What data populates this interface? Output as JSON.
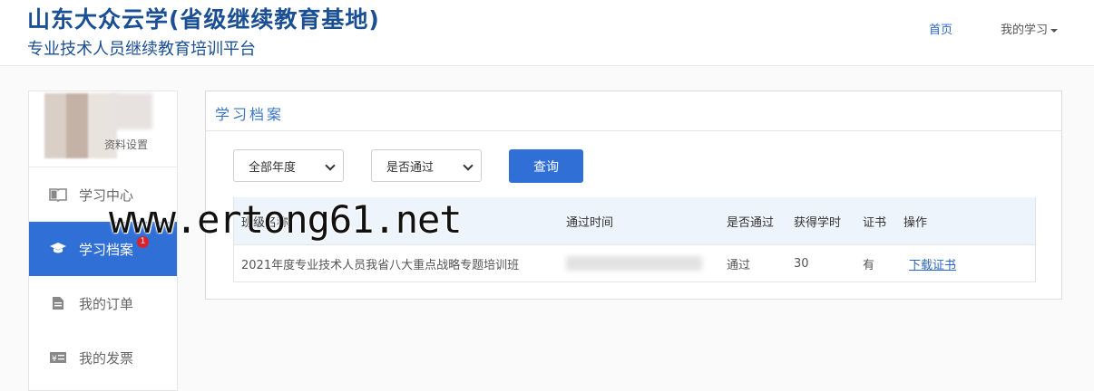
{
  "header": {
    "brand_title": "山东大众云学(省级继续教育基地)",
    "brand_subtitle": "专业技术人员继续教育培训平台",
    "nav_home": "首页",
    "nav_my_study": "我的学习"
  },
  "sidebar": {
    "profile_settings": "资料设置",
    "items": [
      {
        "label": "学习中心",
        "icon": "book-icon"
      },
      {
        "label": "学习档案",
        "icon": "graduation-cap-icon",
        "badge": "1",
        "active": true
      },
      {
        "label": "我的订单",
        "icon": "document-icon"
      },
      {
        "label": "我的发票",
        "icon": "invoice-icon"
      }
    ]
  },
  "panel": {
    "title": "学习档案",
    "filters": {
      "year_selected": "全部年度",
      "pass_selected": "是否通过"
    },
    "query_button": "查询",
    "table": {
      "headers": [
        "班级名称",
        "通过时间",
        "是否通过",
        "获得学时",
        "证书",
        "操作"
      ],
      "rows": [
        {
          "name": "2021年度专业技术人员我省八大重点战略专题培训班",
          "pass_time": "",
          "passed": "通过",
          "hours": "30",
          "certificate": "有",
          "action": "下载证书"
        }
      ]
    }
  },
  "watermark": "www.ertong61.net",
  "colors": {
    "brand": "#1b4f93",
    "accent": "#2f6fd6",
    "badge": "#d9232b"
  }
}
